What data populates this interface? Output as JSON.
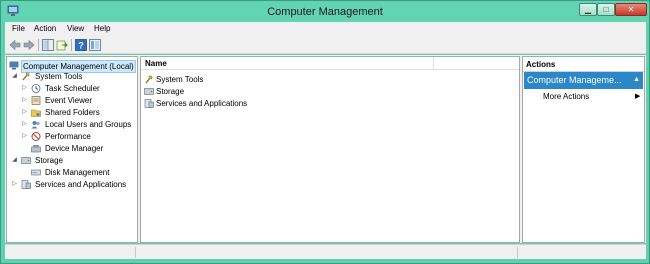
{
  "window": {
    "title": "Computer Management",
    "controls": {
      "minimize_icon": "minimize-icon",
      "maximize_icon": "maximize-icon",
      "close_icon": "close-icon"
    }
  },
  "menubar": {
    "items": [
      {
        "label": "File"
      },
      {
        "label": "Action"
      },
      {
        "label": "View"
      },
      {
        "label": "Help"
      }
    ]
  },
  "toolbar": {
    "buttons": [
      "back-arrow-icon",
      "forward-arrow-icon",
      "show-hide-tree-icon",
      "export-list-icon",
      "help-icon",
      "properties-icon"
    ]
  },
  "tree": {
    "items": [
      {
        "label": "Computer Management (Local)",
        "icon": "computer-management-icon",
        "expander": "",
        "selected": true
      },
      {
        "label": "System Tools",
        "icon": "tools-icon",
        "expander": "◢"
      },
      {
        "label": "Task Scheduler",
        "icon": "clock-icon",
        "expander": "▷"
      },
      {
        "label": "Event Viewer",
        "icon": "event-viewer-icon",
        "expander": "▷"
      },
      {
        "label": "Shared Folders",
        "icon": "shared-folder-icon",
        "expander": "▷"
      },
      {
        "label": "Local Users and Groups",
        "icon": "users-icon",
        "expander": "▷"
      },
      {
        "label": "Performance",
        "icon": "performance-icon",
        "expander": "▷"
      },
      {
        "label": "Device Manager",
        "icon": "device-manager-icon",
        "expander": ""
      },
      {
        "label": "Storage",
        "icon": "storage-icon",
        "expander": "◢"
      },
      {
        "label": "Disk Management",
        "icon": "disk-icon",
        "expander": ""
      },
      {
        "label": "Services and Applications",
        "icon": "services-icon",
        "expander": "▷"
      }
    ]
  },
  "list": {
    "column_name": "Name",
    "rows": [
      {
        "label": "System Tools",
        "icon": "tools-icon"
      },
      {
        "label": "Storage",
        "icon": "storage-icon"
      },
      {
        "label": "Services and Applications",
        "icon": "services-icon"
      }
    ]
  },
  "actions": {
    "title": "Actions",
    "group_label": "Computer Manageme...",
    "group_arrow": "▲",
    "more_actions": "More Actions",
    "more_arrow": "▶"
  },
  "colors": {
    "accent": "#2c87c8",
    "titlebar": "#62d3b3",
    "close": "#c7392b"
  }
}
